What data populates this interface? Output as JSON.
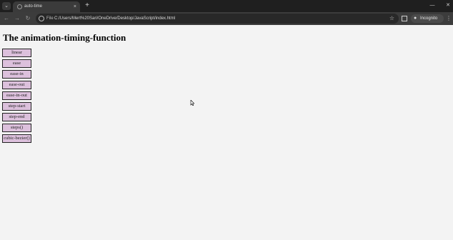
{
  "browser": {
    "tab_title": "auto-time",
    "new_tab_label": "+",
    "tab_close_label": "×",
    "scheme_label": "File",
    "url": "C:/Users/Mert%20Sari/OneDrive/Desktop/JavaScript/index.html",
    "incognito_label": "Incognito"
  },
  "page": {
    "heading": "The animation-timing-function",
    "items": [
      {
        "label": "linear"
      },
      {
        "label": "ease"
      },
      {
        "label": "ease-in"
      },
      {
        "label": "ease-out"
      },
      {
        "label": "ease-in-out"
      },
      {
        "label": "step-start"
      },
      {
        "label": "step-end"
      },
      {
        "label": "steps()"
      },
      {
        "label": "cubic-bezier()"
      }
    ]
  },
  "colors": {
    "item_background": "#dcc0dc",
    "page_background": "#f3f3f3",
    "chrome_dark": "#1f1f1f"
  }
}
